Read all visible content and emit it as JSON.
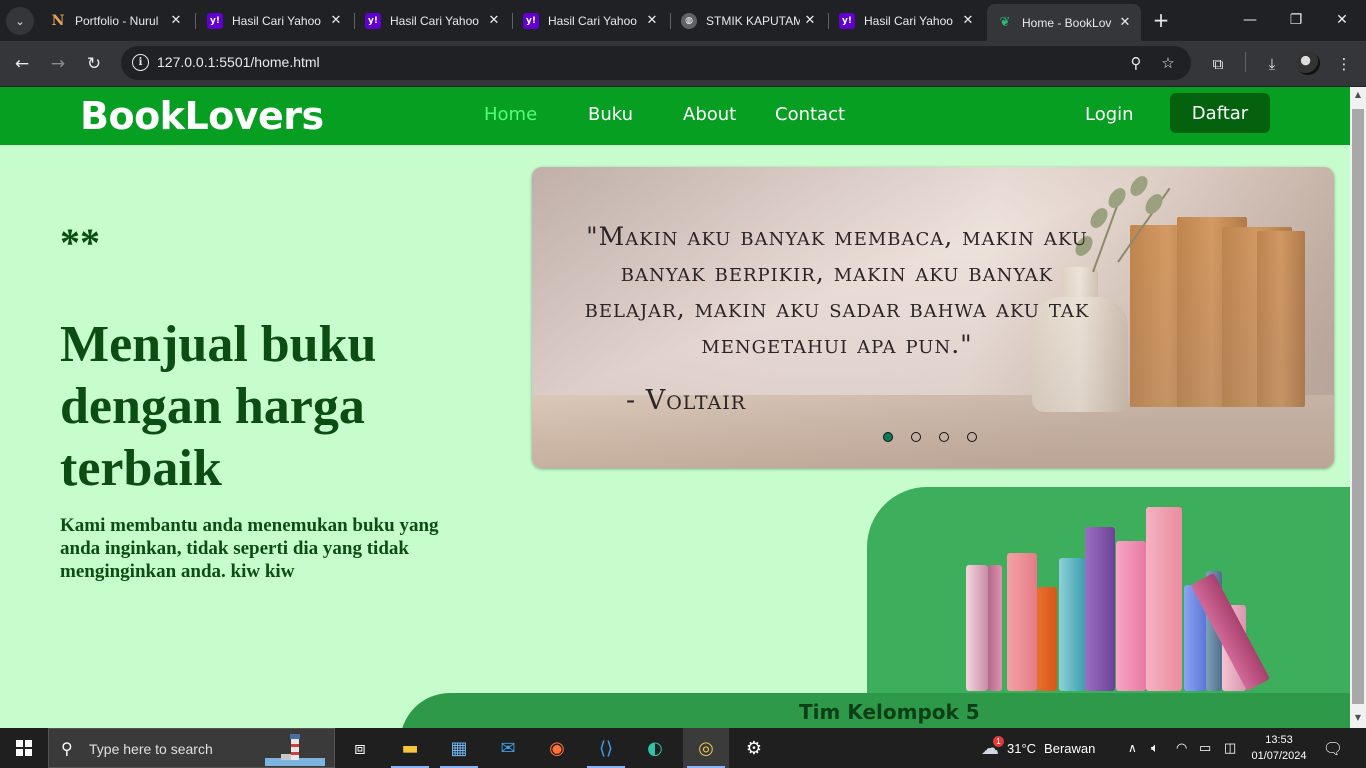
{
  "browser": {
    "tabs": [
      {
        "title": "Portfolio - Nurul",
        "favicon": "notion-n-icon"
      },
      {
        "title": "Hasil Cari Yahoo",
        "favicon": "yahoo-icon"
      },
      {
        "title": "Hasil Cari Yahoo",
        "favicon": "yahoo-icon"
      },
      {
        "title": "Hasil Cari Yahoo",
        "favicon": "yahoo-icon"
      },
      {
        "title": "STMIK KAPUTAM",
        "favicon": "globe-icon"
      },
      {
        "title": "Hasil Cari Yahoo",
        "favicon": "yahoo-icon"
      },
      {
        "title": "Home - BookLov",
        "favicon": "booklovers-icon",
        "active": true
      }
    ],
    "url": "127.0.0.1:5501/home.html"
  },
  "site": {
    "brand": "BookLovers",
    "nav": [
      "Home",
      "Buku",
      "About",
      "Contact"
    ],
    "login": "Login",
    "register": "Daftar",
    "accent_color": "#069f22",
    "background_color": "#c7fdcc"
  },
  "hero": {
    "stars": "**",
    "title": "Menjual buku dengan harga terbaik",
    "subtitle": "Kami membantu anda menemukan buku yang anda inginkan, tidak seperti dia yang tidak menginginkan anda. kiw kiw"
  },
  "carousel": {
    "quote": "\"Makin aku banyak membaca, makin aku banyak berpikir, makin aku banyak belajar, makin aku sadar bahwa aku tak mengetahui apa pun.\"",
    "author": "- Voltair",
    "slide_count": 4,
    "active_slide": 1
  },
  "footer": {
    "text": "Tim Kelompok 5"
  },
  "taskbar": {
    "search_placeholder": "Type here to search",
    "weather_temp": "31°C",
    "weather_desc": "Berawan",
    "weather_badge": "1",
    "time": "13:53",
    "date": "01/07/2024"
  }
}
